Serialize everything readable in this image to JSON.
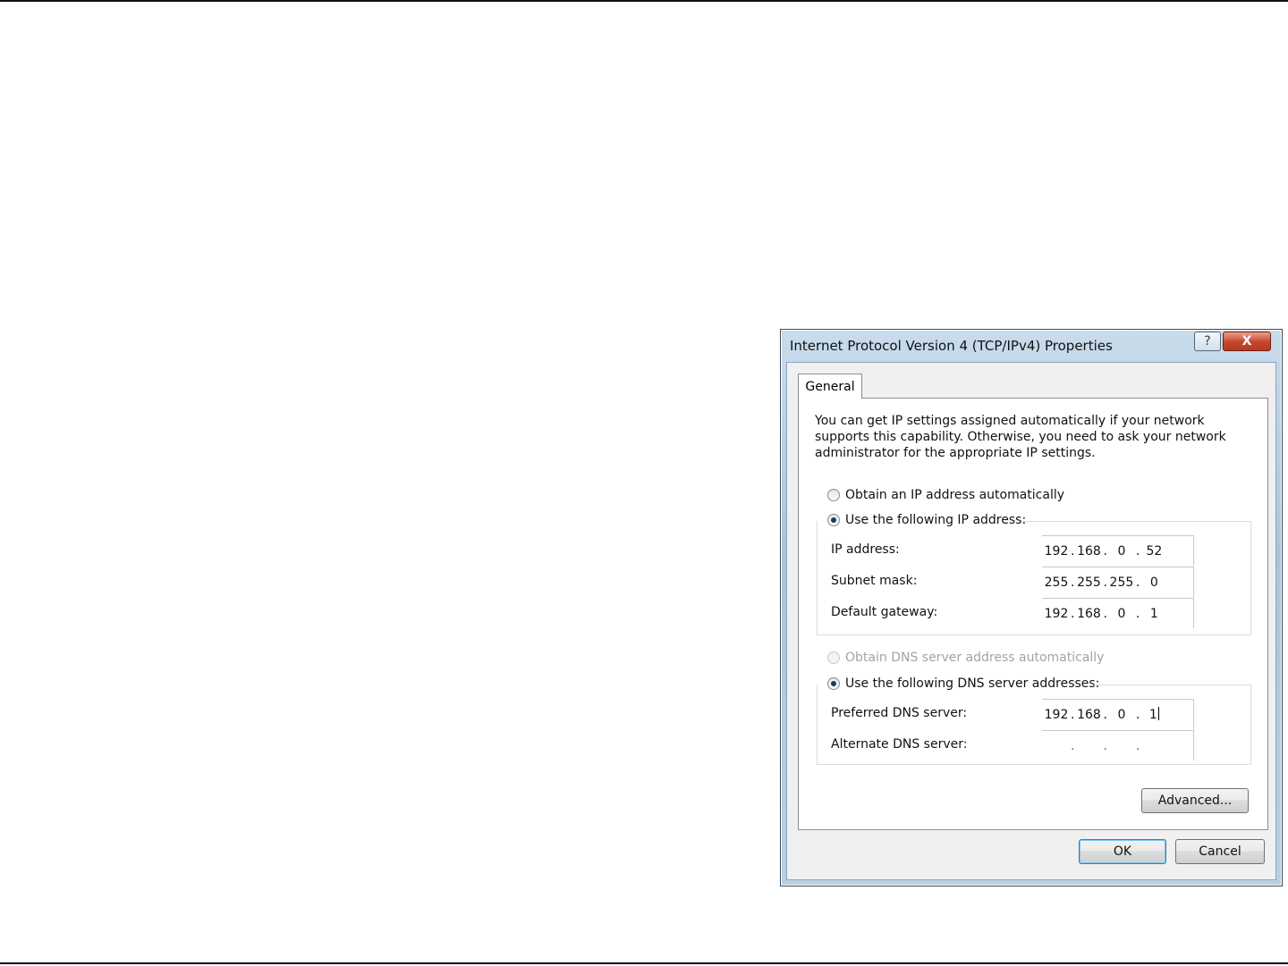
{
  "dialog": {
    "title": "Internet Protocol Version 4 (TCP/IPv4) Properties",
    "help_label": "?",
    "close_label": "X",
    "tab_general": "General",
    "description": "You can get IP settings assigned automatically if your network supports this capability. Otherwise, you need to ask your network administrator for the appropriate IP settings.",
    "ip_mode": {
      "obtain_auto_label": "Obtain an IP address automatically",
      "use_following_label": "Use the following IP address:",
      "selected": "use_following"
    },
    "ip_fields": {
      "ip_address_label": "IP address:",
      "ip_address": [
        "192",
        "168",
        "0",
        "52"
      ],
      "subnet_mask_label": "Subnet mask:",
      "subnet_mask": [
        "255",
        "255",
        "255",
        "0"
      ],
      "default_gateway_label": "Default gateway:",
      "default_gateway": [
        "192",
        "168",
        "0",
        "1"
      ]
    },
    "dns_mode": {
      "obtain_auto_label": "Obtain DNS server address automatically",
      "use_following_label": "Use the following DNS server addresses:",
      "selected": "use_following",
      "obtain_auto_enabled": false
    },
    "dns_fields": {
      "preferred_label": "Preferred DNS server:",
      "preferred": [
        "192",
        "168",
        "0",
        "1"
      ],
      "alternate_label": "Alternate DNS server:",
      "alternate": [
        "",
        "",
        "",
        ""
      ]
    },
    "advanced_label": "Advanced...",
    "ok_label": "OK",
    "cancel_label": "Cancel"
  }
}
